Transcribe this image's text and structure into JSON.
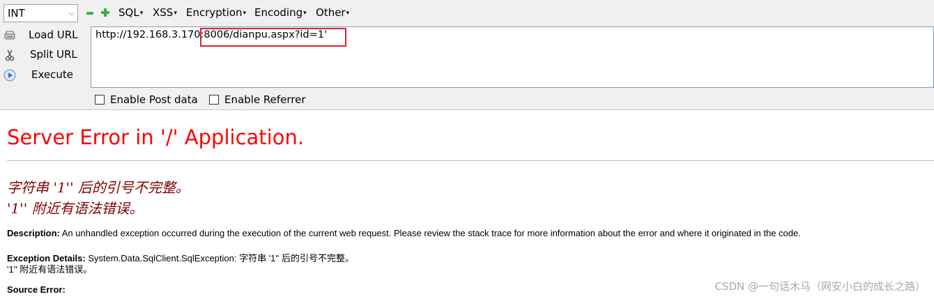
{
  "toolbar": {
    "type_select": "INT",
    "menus": {
      "sql": "SQL",
      "xss": "XSS",
      "encryption": "Encryption",
      "encoding": "Encoding",
      "other": "Other"
    },
    "actions": {
      "load_url": "Load URL",
      "split_url": "Split URL",
      "execute": "Execute"
    },
    "url": "http://192.168.3.170:8006/dianpu.aspx?id=1'",
    "enable_post": "Enable Post data",
    "enable_referrer": "Enable Referrer"
  },
  "error_page": {
    "title": "Server Error in '/' Application.",
    "message_line1": "字符串 '1'' 后的引号不完整。",
    "message_line2": "'1'' 附近有语法错误。",
    "description_label": "Description:",
    "description_text": " An unhandled exception occurred during the execution of the current web request. Please review the stack trace for more information about the error and where it originated in the code.",
    "exception_label": "Exception Details:",
    "exception_text": " System.Data.SqlClient.SqlException: 字符串 '1'' 后的引号不完整。",
    "exception_line2": "'1'' 附近有语法错误。",
    "source_error_label": "Source Error:"
  },
  "watermark": "CSDN @一句话木马（网安小白的成长之路）"
}
